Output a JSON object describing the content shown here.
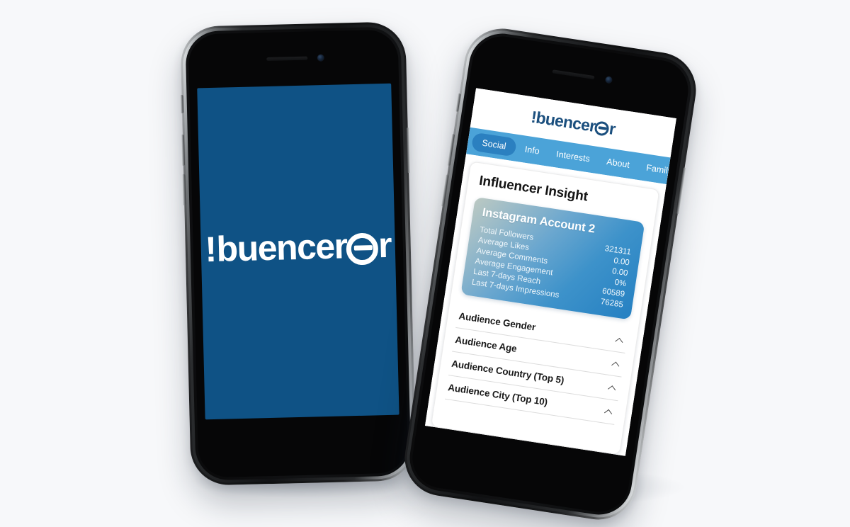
{
  "scene": {
    "background_color": "#f7f8fa",
    "brand_color": "#1b4f7e",
    "accent_color": "#4ba3d8",
    "active_tab_color": "#2b80c0",
    "splash_color": "#0f5285"
  },
  "splash_phone": {
    "name": "splash-screen",
    "logo_text": "buencer",
    "logo_prefix": "!",
    "logo_suffix": "r"
  },
  "app_phone": {
    "header": {
      "logo_prefix": "!",
      "logo_text": "buencer",
      "logo_suffix": "r"
    },
    "tabs": [
      {
        "label": "Social",
        "active": true
      },
      {
        "label": "Info",
        "active": false
      },
      {
        "label": "Interests",
        "active": false
      },
      {
        "label": "About",
        "active": false
      },
      {
        "label": "Family",
        "active": false
      }
    ],
    "panel": {
      "title": "Influencer Insight",
      "insight_card": {
        "title": "Instagram Account 2",
        "metrics": [
          {
            "label": "Total Followers",
            "value": "321311"
          },
          {
            "label": "Average Likes",
            "value": "0.00"
          },
          {
            "label": "Average Comments",
            "value": "0.00"
          },
          {
            "label": "Average Engagement",
            "value": "0%"
          },
          {
            "label": "Last 7-days Reach",
            "value": "60589"
          },
          {
            "label": "Last 7-days Impressions",
            "value": "76285"
          }
        ]
      },
      "accordions": [
        {
          "label": "Audience Gender",
          "icon": "chevron-up-icon"
        },
        {
          "label": "Audience Age",
          "icon": "chevron-up-icon"
        },
        {
          "label": "Audience Country (Top 5)",
          "icon": "chevron-up-icon"
        },
        {
          "label": "Audience City (Top 10)",
          "icon": "chevron-up-icon"
        }
      ]
    }
  }
}
